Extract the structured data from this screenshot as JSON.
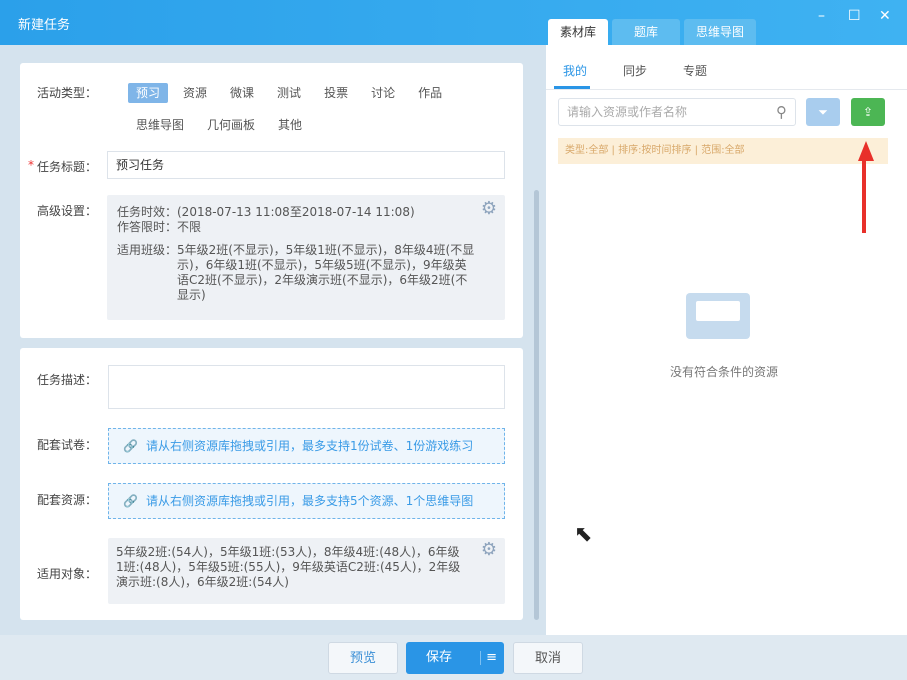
{
  "window": {
    "title": "新建任务",
    "minimize": "–",
    "maximize": "☐",
    "close": "✕"
  },
  "right_tabs": [
    "素材库",
    "题库",
    "思维导图"
  ],
  "sub_tabs": [
    "我的",
    "同步",
    "专题"
  ],
  "search": {
    "placeholder": "请输入资源或作者名称"
  },
  "filter_info": "类型:全部 | 排序:按时间排序 | 范围:全部",
  "empty_text": "没有符合条件的资源",
  "form": {
    "activity_type_label": "活动类型：",
    "activity_types": [
      "预习",
      "资源",
      "微课",
      "测试",
      "投票",
      "讨论",
      "作品",
      "思维导图",
      "几何画板",
      "其他"
    ],
    "task_title_label": "任务标题：",
    "required_mark": "*",
    "task_title_value": "预习任务",
    "advanced_label": "高级设置：",
    "advanced": {
      "validity": "任务时效：(2018-07-13 11:08至2018-07-14 11:08)",
      "time_limit": "作答限时：不限",
      "classes_label": "适用班级：",
      "classes": "5年级2班(不显示)，5年级1班(不显示)，8年级4班(不显示)，6年级1班(不显示)，5年级5班(不显示)，9年级英语C2班(不显示)，2年级演示班(不显示)，6年级2班(不显示)"
    },
    "desc_label": "任务描述：",
    "paper_label": "配套试卷：",
    "paper_hint": "请从右侧资源库拖拽或引用，最多支持1份试卷、1份游戏练习",
    "resource_label": "配套资源：",
    "resource_hint": "请从右侧资源库拖拽或引用，最多支持5个资源、1个思维导图",
    "target_label": "适用对象：",
    "target_value": "5年级2班:(54人)，5年级1班:(53人)，8年级4班:(48人)，6年级1班:(48人)，5年级5班:(55人)，9年级英语C2班:(45人)，2年级演示班:(8人)，6年级2班:(54人)"
  },
  "buttons": {
    "preview": "预览",
    "save": "保存",
    "save_menu": "≡",
    "cancel": "取消"
  }
}
